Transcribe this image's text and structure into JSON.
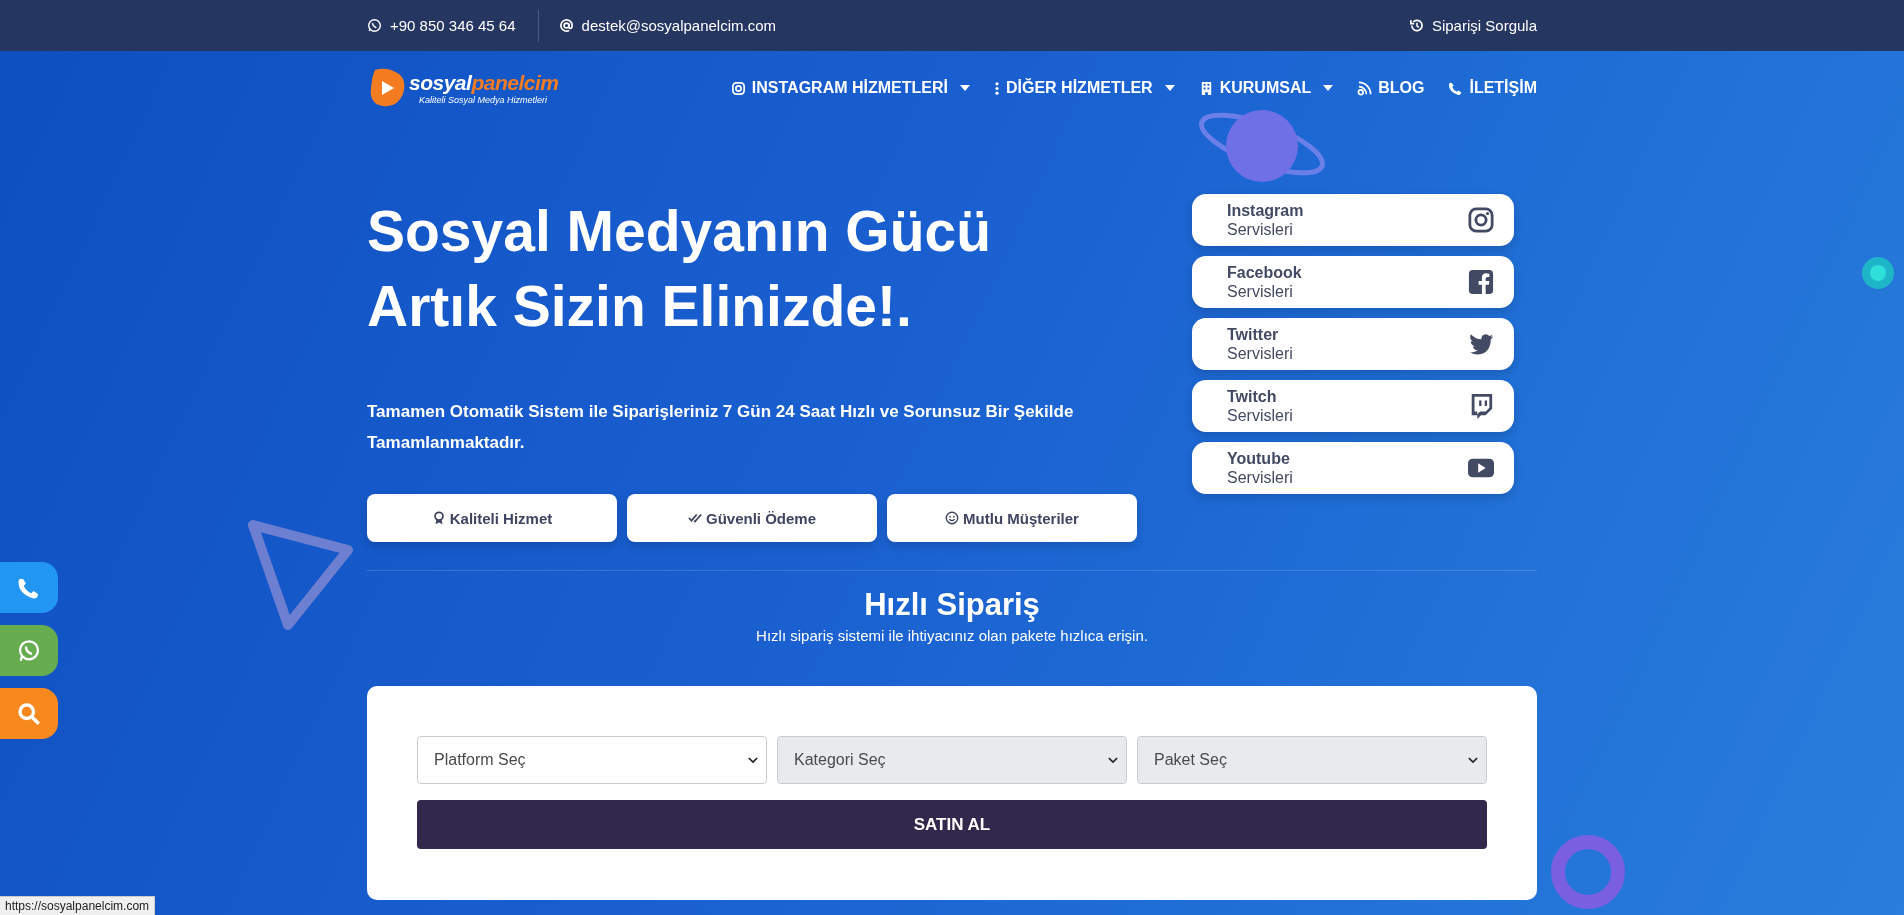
{
  "top_bar": {
    "phone": "+90 850 346 45 64",
    "email": "destek@sosyalpanelcim.com",
    "order_query": "Siparişi Sorgula"
  },
  "logo": {
    "name_1": "sosyal",
    "name_2": "panelcim",
    "tagline": "Kaliteli Sosyal Medya Hizmetleri"
  },
  "nav": [
    {
      "kind": "instagram",
      "label": "INSTAGRAM HİZMETLERİ",
      "dropdown": true
    },
    {
      "kind": "more",
      "label": "DİĞER HİZMETLER",
      "dropdown": true
    },
    {
      "kind": "building",
      "label": "KURUMSAL",
      "dropdown": true
    },
    {
      "kind": "blog",
      "label": "BLOG",
      "dropdown": false
    },
    {
      "kind": "phone",
      "label": "İLETİŞİM",
      "dropdown": false
    }
  ],
  "hero": {
    "title_lines": [
      "Sosyal Medyanın Gücü",
      "Artık Sizin Elinizde!."
    ],
    "description": "Tamamen Otomatik Sistem ile Siparişleriniz 7 Gün 24 Saat Hızlı ve Sorunsuz Bir Şekilde Tamamlanmaktadır.",
    "features": [
      {
        "kind": "award",
        "label": "Kaliteli Hizmet"
      },
      {
        "kind": "check",
        "label": "Güvenli Ödeme"
      },
      {
        "kind": "smile",
        "label": "Mutlu Müşteriler"
      }
    ]
  },
  "services": [
    {
      "kind": "instagram",
      "name": "Instagram",
      "sub": "Servisleri"
    },
    {
      "kind": "facebook",
      "name": "Facebook",
      "sub": "Servisleri"
    },
    {
      "kind": "twitter",
      "name": "Twitter",
      "sub": "Servisleri"
    },
    {
      "kind": "twitch",
      "name": "Twitch",
      "sub": "Servisleri"
    },
    {
      "kind": "youtube",
      "name": "Youtube",
      "sub": "Servisleri"
    }
  ],
  "quick_order": {
    "title": "Hızlı Sipariş",
    "subtitle": "Hızlı sipariş sistemi ile ihtiyacınız olan pakete hızlıca erişin.",
    "selects": [
      {
        "placeholder": "Platform Seç",
        "disabled": false
      },
      {
        "placeholder": "Kategori Seç",
        "disabled": true
      },
      {
        "placeholder": "Paket Seç",
        "disabled": true
      }
    ],
    "button": "SATIN AL"
  },
  "float_buttons": [
    {
      "kind": "phone",
      "color": "#2196f3"
    },
    {
      "kind": "whatsapp",
      "color": "#67ad4f"
    },
    {
      "kind": "search",
      "color": "#f7891f"
    }
  ],
  "status_url": "https://sosyalpanelcim.com"
}
